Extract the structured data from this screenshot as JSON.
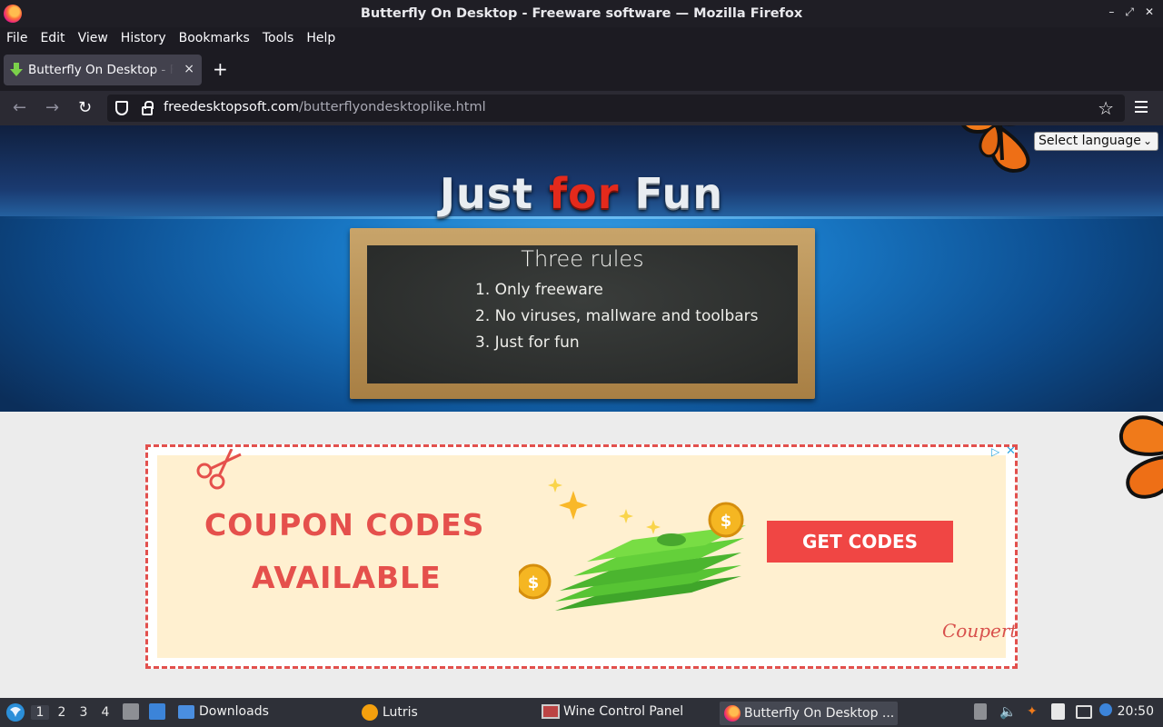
{
  "window": {
    "title": "Butterfly On Desktop - Freeware software — Mozilla Firefox",
    "controls": [
      "–",
      "⤢",
      "✕"
    ]
  },
  "menu": [
    "File",
    "Edit",
    "View",
    "History",
    "Bookmarks",
    "Tools",
    "Help"
  ],
  "tab": {
    "title": "Butterfly On Desktop - Freeware software",
    "close": "×"
  },
  "new_tab_label": "+",
  "nav": {
    "back": "←",
    "forward": "→",
    "reload": "↻",
    "star": "☆"
  },
  "url": {
    "host": "freedesktopsoft.com",
    "path": "/butterflyondesktoplike.html"
  },
  "page": {
    "language_select": "Select language",
    "logo": [
      "Just ",
      "for",
      " Fun"
    ],
    "board": {
      "title": "Three rules",
      "rules": [
        "1. Only freeware",
        "2. No viruses, mallware and toolbars",
        "3. Just for fun"
      ]
    },
    "ad": {
      "headline1": "COUPON CODES",
      "headline2": "AVAILABLE",
      "cta": "GET CODES",
      "brand": "Coupert",
      "adchoices": "▷",
      "close": "✕"
    }
  },
  "taskbar": {
    "workspaces": [
      "1",
      "2",
      "3",
      "4"
    ],
    "apps": [
      "Downloads",
      "Lutris",
      "Wine Control Panel",
      "Butterfly On Desktop ..."
    ],
    "clock": "20:50"
  },
  "colors": {
    "ad_accent": "#e5504c",
    "logo_red": "#e42a1c",
    "chrome_dark": "#1c1b22"
  }
}
